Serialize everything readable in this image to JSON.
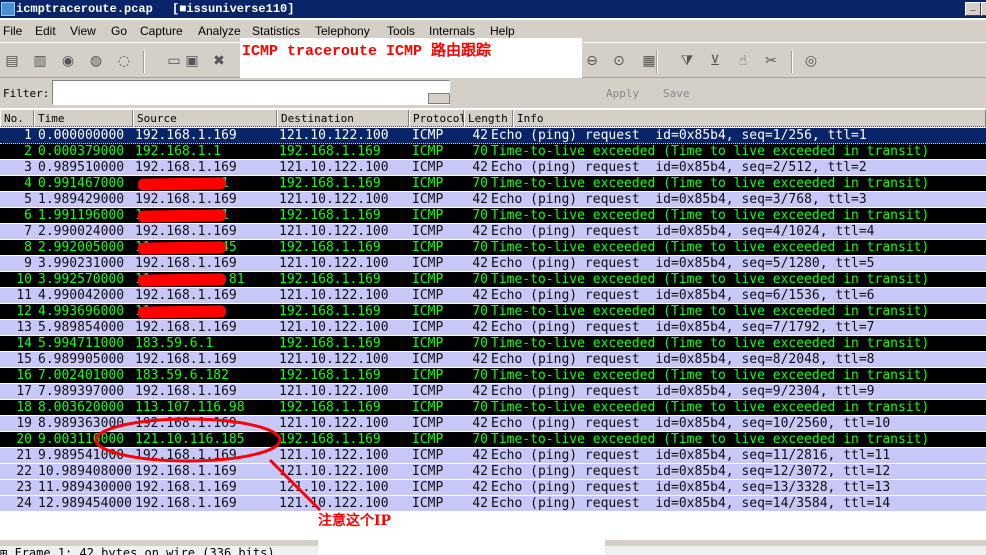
{
  "window": {
    "title": "icmptraceroute.pcap",
    "subtitle": "[■issuniverse110]",
    "minimize": "_"
  },
  "menu": [
    "File",
    "Edit",
    "View",
    "Go",
    "Capture",
    "Analyze",
    "Statistics",
    "Telephony",
    "Tools",
    "Internals",
    "Help"
  ],
  "toolbar_icons": [
    "interface-list-icon",
    "capture-options-icon",
    "start-capture-icon",
    "stop-capture-icon",
    "restart-capture-icon",
    "open-file-icon",
    "save-file-icon",
    "close-file-icon",
    "zoom-out-icon",
    "zoom-normal-icon",
    "resize-columns-icon",
    "capture-filter-icon",
    "display-filter-icon",
    "coloring-rules-icon",
    "preferences-icon",
    "help-icon"
  ],
  "annotation_title": "ICMP traceroute ICMP 路由跟踪",
  "filter": {
    "label": "Filter:",
    "value": "",
    "apply": "Apply",
    "save": "Save"
  },
  "columns": [
    "No.",
    "Time",
    "Source",
    "Destination",
    "Protocol",
    "Length",
    "Info"
  ],
  "packets": [
    {
      "no": "1",
      "time": "0.000000000",
      "src": "192.168.1.169",
      "dst": "121.10.122.100",
      "proto": "ICMP",
      "len": "42",
      "info": "Echo (ping) request  id=0x85b4, seq=1/256, ttl=1",
      "type": "sel"
    },
    {
      "no": "2",
      "time": "0.000379000",
      "src": "192.168.1.1",
      "dst": "192.168.1.169",
      "proto": "ICMP",
      "len": "70",
      "info": "Time-to-live exceeded (Time to live exceeded in transit)",
      "type": "ttl"
    },
    {
      "no": "3",
      "time": "0.989510000",
      "src": "192.168.1.169",
      "dst": "121.10.122.100",
      "proto": "ICMP",
      "len": "42",
      "info": "Echo (ping) request  id=0x85b4, seq=2/512, ttl=2",
      "type": "req"
    },
    {
      "no": "4",
      "time": "0.991467000",
      "src": "           1",
      "dst": "192.168.1.169",
      "proto": "ICMP",
      "len": "70",
      "info": "Time-to-live exceeded (Time to live exceeded in transit)",
      "type": "ttl",
      "redacted": true
    },
    {
      "no": "5",
      "time": "1.989429000",
      "src": "192.168.1.169",
      "dst": "121.10.122.100",
      "proto": "ICMP",
      "len": "42",
      "info": "Echo (ping) request  id=0x85b4, seq=3/768, ttl=3",
      "type": "req"
    },
    {
      "no": "6",
      "time": "1.991196000",
      "src": "1          1",
      "dst": "192.168.1.169",
      "proto": "ICMP",
      "len": "70",
      "info": "Time-to-live exceeded (Time to live exceeded in transit)",
      "type": "ttl",
      "redacted": true
    },
    {
      "no": "7",
      "time": "2.990024000",
      "src": "192.168.1.169",
      "dst": "121.10.122.100",
      "proto": "ICMP",
      "len": "42",
      "info": "Echo (ping) request  id=0x85b4, seq=4/1024, ttl=4",
      "type": "req"
    },
    {
      "no": "8",
      "time": "2.992005000",
      "src": "11         45",
      "dst": "192.168.1.169",
      "proto": "ICMP",
      "len": "70",
      "info": "Time-to-live exceeded (Time to live exceeded in transit)",
      "type": "ttl",
      "redacted": true
    },
    {
      "no": "9",
      "time": "3.990231000",
      "src": "192.168.1.169",
      "dst": "121.10.122.100",
      "proto": "ICMP",
      "len": "42",
      "info": "Echo (ping) request  id=0x85b4, seq=5/1280, ttl=5",
      "type": "req"
    },
    {
      "no": "10",
      "time": "3.992570000",
      "src": "11          81",
      "dst": "192.168.1.169",
      "proto": "ICMP",
      "len": "70",
      "info": "Time-to-live exceeded (Time to live exceeded in transit)",
      "type": "ttl",
      "redacted": true
    },
    {
      "no": "11",
      "time": "4.990042000",
      "src": "192.168.1.169",
      "dst": "121.10.122.100",
      "proto": "ICMP",
      "len": "42",
      "info": "Echo (ping) request  id=0x85b4, seq=6/1536, ttl=6",
      "type": "req"
    },
    {
      "no": "12",
      "time": "4.993696000",
      "src": "11",
      "dst": "192.168.1.169",
      "proto": "ICMP",
      "len": "70",
      "info": "Time-to-live exceeded (Time to live exceeded in transit)",
      "type": "ttl",
      "redacted": true
    },
    {
      "no": "13",
      "time": "5.989854000",
      "src": "192.168.1.169",
      "dst": "121.10.122.100",
      "proto": "ICMP",
      "len": "42",
      "info": "Echo (ping) request  id=0x85b4, seq=7/1792, ttl=7",
      "type": "req"
    },
    {
      "no": "14",
      "time": "5.994711000",
      "src": "183.59.6.1",
      "dst": "192.168.1.169",
      "proto": "ICMP",
      "len": "70",
      "info": "Time-to-live exceeded (Time to live exceeded in transit)",
      "type": "ttl"
    },
    {
      "no": "15",
      "time": "6.989905000",
      "src": "192.168.1.169",
      "dst": "121.10.122.100",
      "proto": "ICMP",
      "len": "42",
      "info": "Echo (ping) request  id=0x85b4, seq=8/2048, ttl=8",
      "type": "req"
    },
    {
      "no": "16",
      "time": "7.002401000",
      "src": "183.59.6.182",
      "dst": "192.168.1.169",
      "proto": "ICMP",
      "len": "70",
      "info": "Time-to-live exceeded (Time to live exceeded in transit)",
      "type": "ttl"
    },
    {
      "no": "17",
      "time": "7.989397000",
      "src": "192.168.1.169",
      "dst": "121.10.122.100",
      "proto": "ICMP",
      "len": "42",
      "info": "Echo (ping) request  id=0x85b4, seq=9/2304, ttl=9",
      "type": "req"
    },
    {
      "no": "18",
      "time": "8.003620000",
      "src": "113.107.116.98",
      "dst": "192.168.1.169",
      "proto": "ICMP",
      "len": "70",
      "info": "Time-to-live exceeded (Time to live exceeded in transit)",
      "type": "ttl"
    },
    {
      "no": "19",
      "time": "8.989363000",
      "src": "192.168.1.169",
      "dst": "121.10.122.100",
      "proto": "ICMP",
      "len": "42",
      "info": "Echo (ping) request  id=0x85b4, seq=10/2560, ttl=10",
      "type": "req"
    },
    {
      "no": "20",
      "time": "9.003116000",
      "src": "121.10.116.185",
      "dst": "192.168.1.169",
      "proto": "ICMP",
      "len": "70",
      "info": "Time-to-live exceeded (Time to live exceeded in transit)",
      "type": "ttl"
    },
    {
      "no": "21",
      "time": "9.989541000",
      "src": "192.168.1.169",
      "dst": "121.10.122.100",
      "proto": "ICMP",
      "len": "42",
      "info": "Echo (ping) request  id=0x85b4, seq=11/2816, ttl=11",
      "type": "req"
    },
    {
      "no": "22",
      "time": "10.989408000",
      "src": "192.168.1.169",
      "dst": "121.10.122.100",
      "proto": "ICMP",
      "len": "42",
      "info": "Echo (ping) request  id=0x85b4, seq=12/3072, ttl=12",
      "type": "req"
    },
    {
      "no": "23",
      "time": "11.989430000",
      "src": "192.168.1.169",
      "dst": "121.10.122.100",
      "proto": "ICMP",
      "len": "42",
      "info": "Echo (ping) request  id=0x85b4, seq=13/3328, ttl=13",
      "type": "req"
    },
    {
      "no": "24",
      "time": "12.989454000",
      "src": "192.168.1.169",
      "dst": "121.10.122.100",
      "proto": "ICMP",
      "len": "42",
      "info": "Echo (ping) request  id=0x85b4, seq=14/3584, ttl=14",
      "type": "req"
    }
  ],
  "detail_line": "Frame 1: 42 bytes on wire (336 bits)",
  "annotation_note": "注意这个IP",
  "colors": {
    "selected": "#0a246a",
    "request_bg": "#c8c8f8",
    "ttl_bg": "#000000",
    "ttl_fg": "#10ff10",
    "annotation": "#ff0000"
  }
}
